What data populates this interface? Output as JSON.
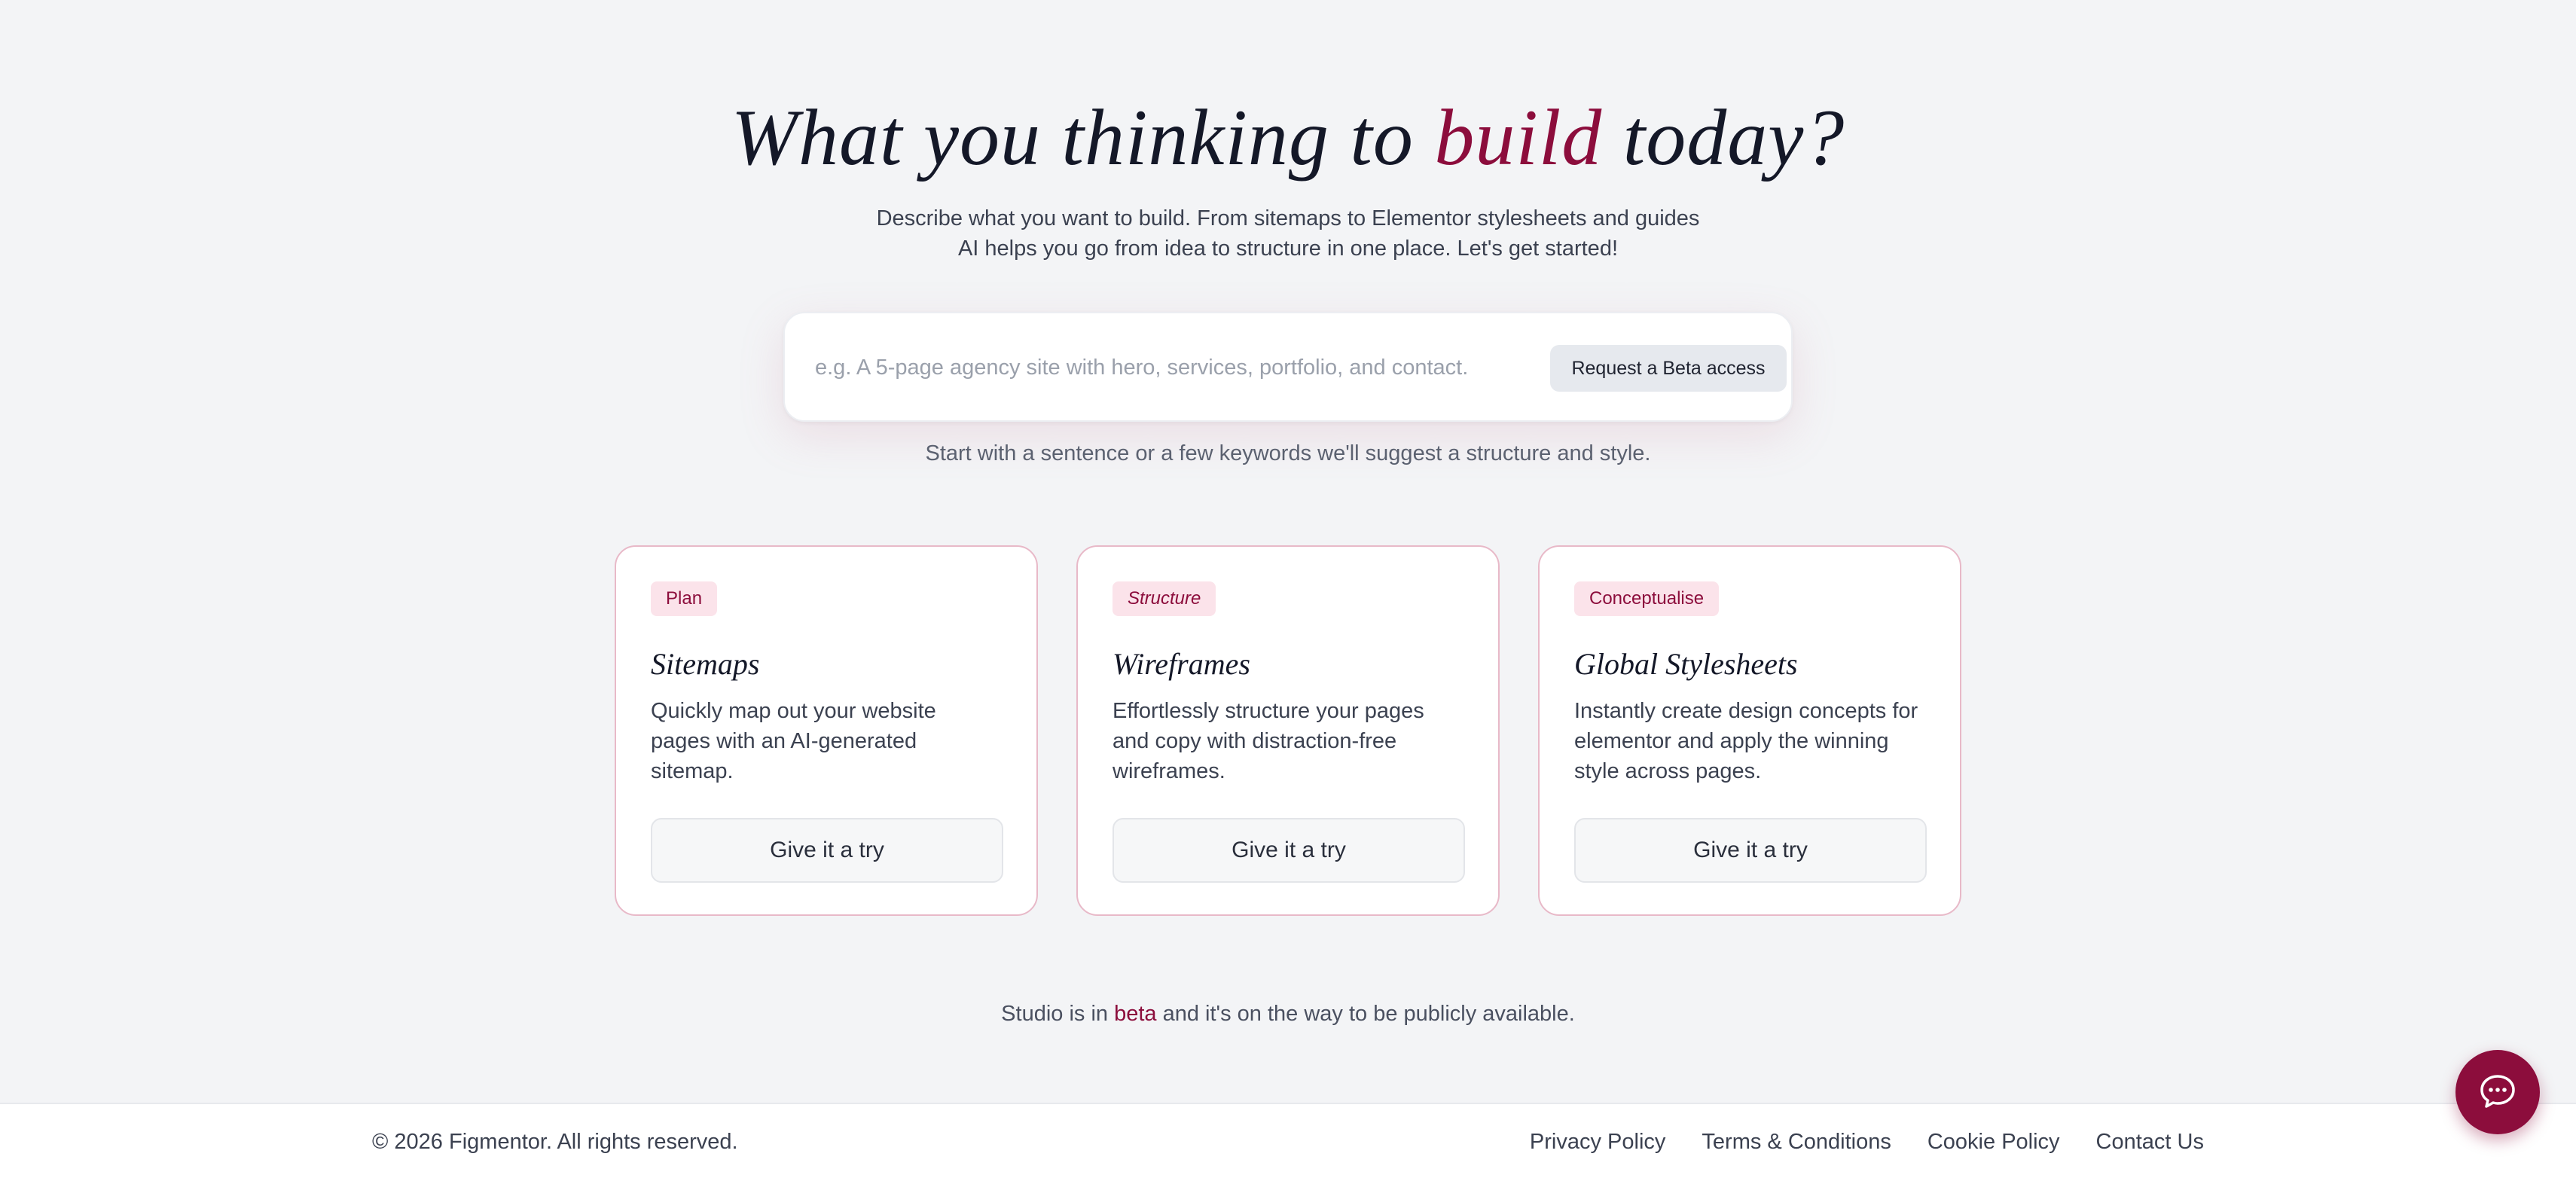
{
  "hero": {
    "title_pre": "What you thinking to ",
    "title_accent": "build",
    "title_post": " today?",
    "subtitle_line1": "Describe what you want to build. From sitemaps to Elementor stylesheets and guides",
    "subtitle_line2": "AI helps you go from idea to structure in one place. Let's get started!"
  },
  "search": {
    "placeholder": "e.g. A 5-page agency site with hero, services, portfolio, and contact.",
    "value": "",
    "button_label": "Request a Beta access",
    "hint": "Start with a sentence or a few keywords we'll suggest a structure and style."
  },
  "cards": [
    {
      "badge": "Plan",
      "title": "Sitemaps",
      "description": "Quickly map out your website pages with an AI-generated sitemap.",
      "button_label": "Give it a try"
    },
    {
      "badge": "Structure",
      "title": "Wireframes",
      "description": "Effortlessly structure your pages and copy with distraction-free wireframes.",
      "button_label": "Give it a try"
    },
    {
      "badge": "Conceptualise",
      "title": "Global Stylesheets",
      "description": "Instantly create design concepts for elementor and apply the winning style across pages.",
      "button_label": "Give it a try"
    }
  ],
  "beta_note": {
    "pre": "Studio is in ",
    "accent": "beta",
    "post": " and it's on the way to be publicly available."
  },
  "footer": {
    "copyright": "© 2026 Figmentor. All rights reserved.",
    "links": [
      "Privacy Policy",
      "Terms & Conditions",
      "Cookie Policy",
      "Contact Us"
    ]
  },
  "chat": {
    "icon": "chat-bubble-icon"
  },
  "colors": {
    "accent": "#8c0d3c",
    "background": "#f3f4f6",
    "badge_bg": "#fbe3ea",
    "card_border": "#e8b9c8"
  }
}
